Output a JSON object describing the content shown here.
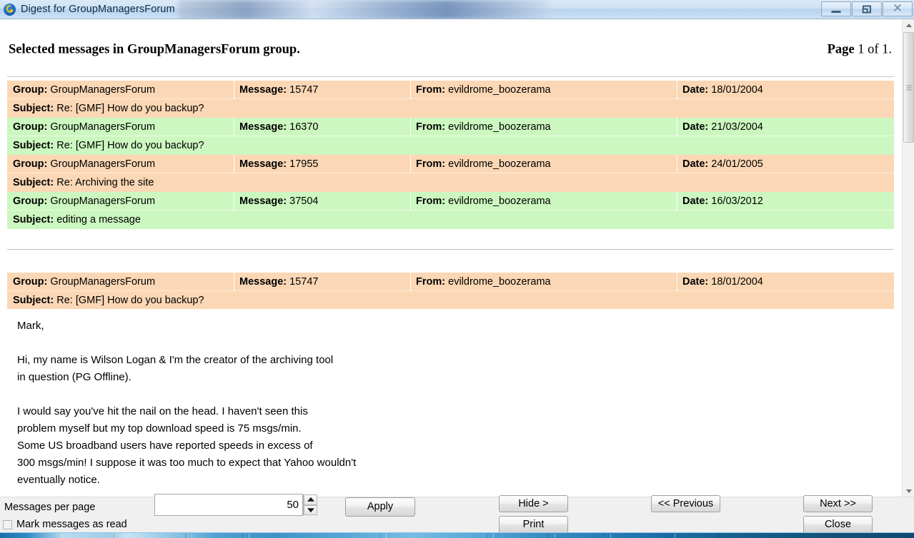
{
  "window": {
    "title": "Digest for GroupManagersForum",
    "icon": "pg-offline-logo-icon",
    "minimize_label": "Minimize",
    "restore_label": "Restore",
    "close_label": "Close"
  },
  "page": {
    "heading": "Selected messages in GroupManagersForum group.",
    "pager_prefix": "Page",
    "pager_value": " 1 of 1."
  },
  "labels": {
    "group": "Group:",
    "message": "Message:",
    "from": "From:",
    "date": "Date:",
    "subject": "Subject:"
  },
  "messages": [
    {
      "group": "GroupManagersForum",
      "message": "15747",
      "from": "evildrome_boozerama",
      "date": "18/01/2004",
      "subject": "Re: [GMF] How do you backup?",
      "row_color": "#fbd7b5",
      "color_name": "peach"
    },
    {
      "group": "GroupManagersForum",
      "message": "16370",
      "from": "evildrome_boozerama",
      "date": "21/03/2004",
      "subject": "Re: [GMF] How do you backup?",
      "row_color": "#ccf7c0",
      "color_name": "green"
    },
    {
      "group": "GroupManagersForum",
      "message": "17955",
      "from": "evildrome_boozerama",
      "date": "24/01/2005",
      "subject": "Re: Archiving the site",
      "row_color": "#fbd7b5",
      "color_name": "peach"
    },
    {
      "group": "GroupManagersForum",
      "message": "37504",
      "from": "evildrome_boozerama",
      "date": "16/03/2012",
      "subject": "editing a message",
      "row_color": "#ccf7c0",
      "color_name": "green"
    }
  ],
  "detail": {
    "group": "GroupManagersForum",
    "message": "15747",
    "from": "evildrome_boozerama",
    "date": "18/01/2004",
    "subject": "Re: [GMF] How do you backup?",
    "row_color": "#fbd7b5",
    "body": "Mark,\n\nHi, my name is Wilson Logan & I'm the creator of the archiving tool\nin question (PG Offline).\n\nI would say you've hit the nail on the head. I haven't seen this\nproblem myself but my top download speed is 75 msgs/min.\nSome US broadband users have reported speeds in excess of\n300 msgs/min! I suppose it was too much to expect that Yahoo wouldn't\neventually notice.\n\nI have created a new FAQ entry on my site which deals with this"
  },
  "toolbar": {
    "messages_per_page_label": "Messages per page",
    "messages_per_page_value": "50",
    "messages_per_page_placeholder": "50",
    "apply_label": "Apply",
    "hide_label": "Hide >",
    "print_label": "Print",
    "previous_label": "<< Previous",
    "next_label": "Next >>",
    "close_label": "Close",
    "mark_read_label": "Mark messages as read",
    "mark_read_checked": false,
    "spin_up_icon": "chevron-up-icon",
    "spin_down_icon": "chevron-down-icon"
  },
  "scrollbar": {
    "up_icon": "scroll-up-arrow-icon",
    "down_icon": "scroll-down-arrow-icon",
    "thumb_name": "scroll-thumb"
  }
}
